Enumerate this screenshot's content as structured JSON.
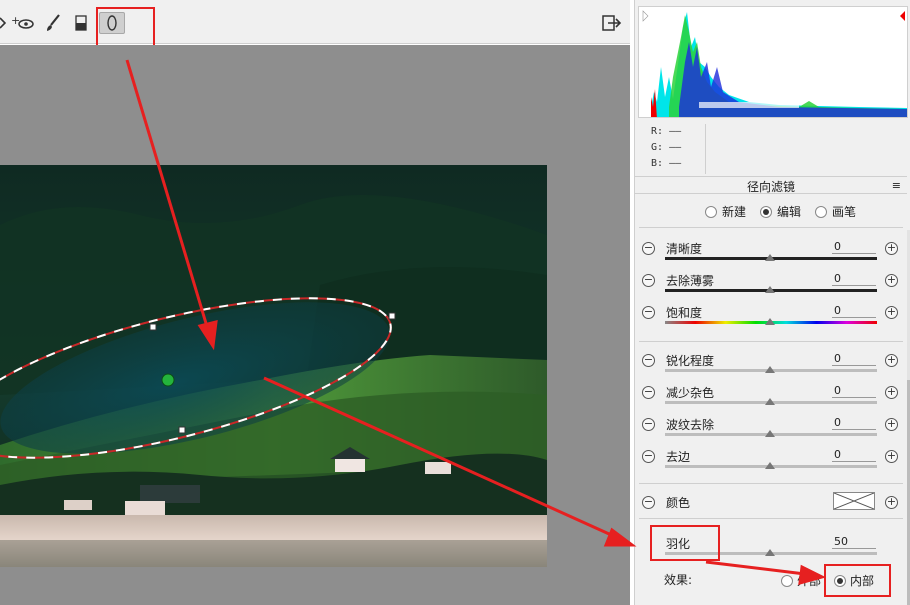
{
  "toolbar": {
    "icons": [
      "crop-partial-icon",
      "add-eye-icon",
      "brush-icon",
      "graduated-filter-icon",
      "radial-filter-icon",
      "export-icon"
    ],
    "add_eye_glyph": "+👁"
  },
  "histogram": {
    "rgb_labels": [
      "R:",
      "G:",
      "B:"
    ],
    "rgb_values": [
      "——",
      "——",
      "——"
    ]
  },
  "panel": {
    "title": "径向滤镜",
    "menu_glyph": "≡",
    "modes": [
      {
        "label": "新建",
        "selected": false
      },
      {
        "label": "编辑",
        "selected": true
      },
      {
        "label": "画笔",
        "selected": false
      }
    ]
  },
  "sliders": [
    {
      "label": "清晰度",
      "value": "0",
      "track": "dark"
    },
    {
      "label": "去除薄雾",
      "value": "0",
      "track": "dark"
    },
    {
      "label": "饱和度",
      "value": "0",
      "track": "sat"
    },
    {
      "label": "锐化程度",
      "value": "0",
      "track": "plain"
    },
    {
      "label": "减少杂色",
      "value": "0",
      "track": "plain"
    },
    {
      "label": "波纹去除",
      "value": "0",
      "track": "plain"
    },
    {
      "label": "去边",
      "value": "0",
      "track": "plain"
    }
  ],
  "color": {
    "label": "颜色"
  },
  "feather": {
    "label": "羽化",
    "value": "50"
  },
  "effect": {
    "label": "效果:",
    "options": [
      {
        "label": "外部",
        "selected": false
      },
      {
        "label": "内部",
        "selected": true
      }
    ]
  },
  "annotation_color": "#e62020"
}
